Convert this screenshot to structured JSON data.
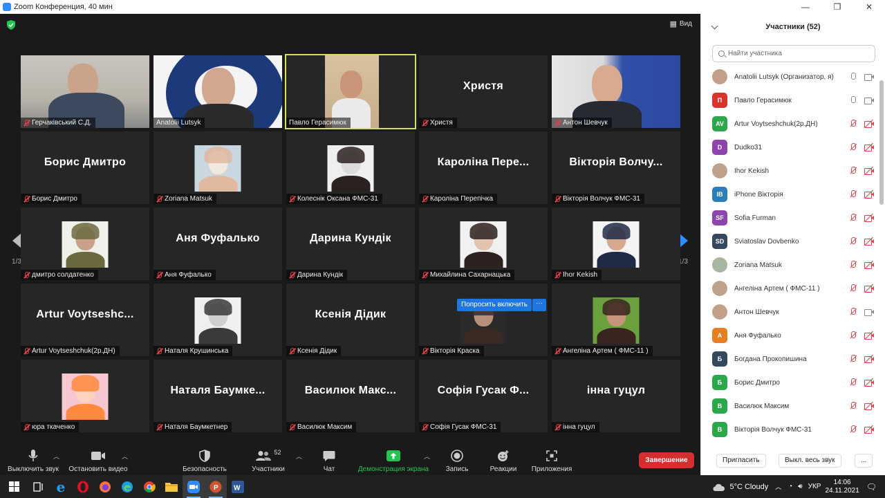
{
  "window": {
    "title": "Zoom Конференция, 40 мин"
  },
  "view_label": "Вид",
  "grid_tiles": [
    {
      "id": "t1",
      "label": "Герчаківський С.Д.",
      "type": "video",
      "muted": true
    },
    {
      "id": "t2",
      "label": "Anatolii Lutsyk",
      "type": "video",
      "muted": false
    },
    {
      "id": "t3",
      "label": "Павло Герасимюк",
      "type": "video",
      "muted": false,
      "active": true
    },
    {
      "id": "t4",
      "big": "Христя",
      "label": "Христя",
      "type": "name",
      "muted": true
    },
    {
      "id": "t5",
      "label": "Антон Шевчук",
      "type": "video",
      "muted": true
    },
    {
      "id": "t6",
      "big": "Борис Дмитро",
      "label": "Борис Дмитро",
      "type": "name",
      "muted": true
    },
    {
      "id": "t7",
      "label": "Zoriana Matsuk",
      "type": "photo",
      "muted": true
    },
    {
      "id": "t8",
      "label": "Колеснік Оксана ФМС-31",
      "type": "photo",
      "muted": true
    },
    {
      "id": "t9",
      "big": "Кароліна Пере...",
      "label": "Кароліна Перепічка",
      "type": "name",
      "muted": true
    },
    {
      "id": "t10",
      "big": "Вікторія Волчу...",
      "label": "Вікторія Волчук ФМС-31",
      "type": "name",
      "muted": true
    },
    {
      "id": "t11",
      "label": "дмитро солдатенко",
      "type": "photo",
      "muted": true
    },
    {
      "id": "t12",
      "big": "Аня Фуфалько",
      "label": "Аня Фуфалько",
      "type": "name",
      "muted": true
    },
    {
      "id": "t13",
      "big": "Дарина Кундік",
      "label": "Дарина Кундік",
      "type": "name",
      "muted": true
    },
    {
      "id": "t14",
      "label": "Михайлина Сахарнацька",
      "type": "photo",
      "muted": true
    },
    {
      "id": "t15",
      "label": "Ihor Kekish",
      "type": "photo",
      "muted": true
    },
    {
      "id": "t16",
      "big": "Artur Voytseshc...",
      "label": "Artur Voytseshchuk(2р.ДН)",
      "type": "name",
      "muted": true
    },
    {
      "id": "t17",
      "label": "Наталя Крушинська",
      "type": "photo",
      "muted": true
    },
    {
      "id": "t18",
      "big": "Ксенія Дідик",
      "label": "Ксенія Дідик",
      "type": "name",
      "muted": true
    },
    {
      "id": "t19",
      "label": "Вікторія Краска",
      "type": "photo",
      "muted": true
    },
    {
      "id": "t20",
      "label": "Ангеліна Артем ( ФМС-11 )",
      "type": "photo",
      "muted": true
    },
    {
      "id": "t21",
      "label": "юра ткаченко",
      "type": "photo",
      "muted": true
    },
    {
      "id": "t22",
      "big": "Наталя Баумке...",
      "label": "Наталя Баумкетнер",
      "type": "name",
      "muted": true
    },
    {
      "id": "t23",
      "big": "Василюк Макс...",
      "label": "Василюк Максим",
      "type": "name",
      "muted": true
    },
    {
      "id": "t24",
      "big": "Софія Гусак Ф...",
      "label": "Софія Гусак ФМС-31",
      "type": "name",
      "muted": true
    },
    {
      "id": "t25",
      "big": "інна гуцул",
      "label": "інна гуцул",
      "type": "name",
      "muted": true
    }
  ],
  "pager": {
    "left": "1/3",
    "right": "1/3"
  },
  "ask_unmute": {
    "label": "Попросить включить",
    "more": "···"
  },
  "toolbar": {
    "mute": "Выключить звук",
    "video": "Остановить видео",
    "security": "Безопасность",
    "participants": "Участники",
    "participants_count": "52",
    "chat": "Чат",
    "share": "Демонстрация экрана",
    "record": "Запись",
    "reactions": "Реакции",
    "apps": "Приложения",
    "end": "Завершение"
  },
  "panel": {
    "title": "Участники (52)",
    "search_placeholder": "Найти участника",
    "invite": "Пригласить",
    "mute_all": "Выкл. весь звук",
    "more": "..."
  },
  "participants": [
    {
      "name": "Anatolii Lutsyk (Организатор, я)",
      "avatar": "",
      "color": "",
      "mic": "on",
      "cam": "on"
    },
    {
      "name": "Павло Герасимюк",
      "avatar": "П",
      "color": "#d9342b",
      "mic": "on",
      "cam": "on"
    },
    {
      "name": "Artur Voytseshchuk(2р.ДН)",
      "avatar": "AV",
      "color": "#2aa84a",
      "mic": "off",
      "cam": "off"
    },
    {
      "name": "Dudko31",
      "avatar": "D",
      "color": "#8e44ad",
      "mic": "off",
      "cam": "off"
    },
    {
      "name": "Ihor Kekish",
      "avatar": "",
      "color": "",
      "mic": "off",
      "cam": "off"
    },
    {
      "name": "iPhone Вікторія",
      "avatar": "IB",
      "color": "#2980b9",
      "mic": "off",
      "cam": "off"
    },
    {
      "name": "Sofia Furman",
      "avatar": "SF",
      "color": "#8e44ad",
      "mic": "off",
      "cam": "off"
    },
    {
      "name": "Sviatoslav Dovbenko",
      "avatar": "SD",
      "color": "#34495e",
      "mic": "off",
      "cam": "off"
    },
    {
      "name": "Zoriana Matsuk",
      "avatar": "",
      "color": "",
      "mic": "off",
      "cam": "off"
    },
    {
      "name": "Ангеліна Артем ( ФМС-11 )",
      "avatar": "",
      "color": "",
      "mic": "off",
      "cam": "off"
    },
    {
      "name": "Антон Шевчук",
      "avatar": "",
      "color": "",
      "mic": "off",
      "cam": "on"
    },
    {
      "name": "Аня Фуфалько",
      "avatar": "А",
      "color": "#e67e22",
      "mic": "off",
      "cam": "off"
    },
    {
      "name": "Богдана Прокопишина",
      "avatar": "Б",
      "color": "#34495e",
      "mic": "off",
      "cam": "off"
    },
    {
      "name": "Борис Дмитро",
      "avatar": "Б",
      "color": "#2aa84a",
      "mic": "off",
      "cam": "off"
    },
    {
      "name": "Василюк Максим",
      "avatar": "В",
      "color": "#2aa84a",
      "mic": "off",
      "cam": "off"
    },
    {
      "name": "Вікторія Волчук ФМС-31",
      "avatar": "В",
      "color": "#2aa84a",
      "mic": "off",
      "cam": "off"
    }
  ],
  "taskbar": {
    "weather": "5°C  Cloudy",
    "lang": "УКР",
    "time": "14:06",
    "date": "24.11.2021"
  }
}
